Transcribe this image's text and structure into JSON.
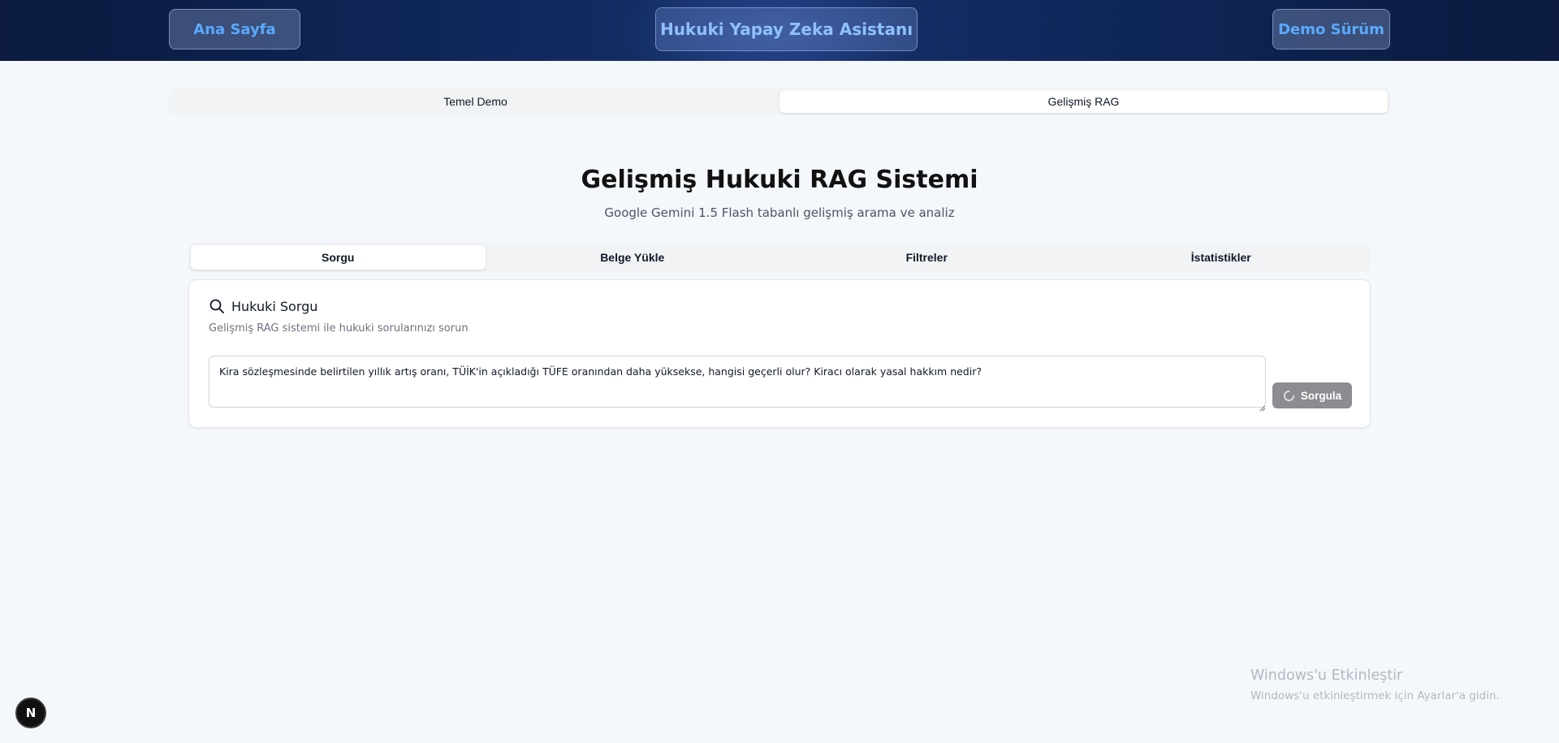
{
  "header": {
    "home_label": "Ana Sayfa",
    "title": "Hukuki Yapay Zeka Asistanı",
    "demo_label": "Demo Sürüm",
    "accent_color": "#5aa9ff",
    "background_color": "#0e2556"
  },
  "mode_tabs": [
    {
      "label": "Temel Demo",
      "active": false
    },
    {
      "label": "Gelişmiş RAG",
      "active": true
    }
  ],
  "page": {
    "title": "Gelişmiş Hukuki RAG Sistemi",
    "subtitle": "Google Gemini 1.5 Flash tabanlı gelişmiş arama ve analiz"
  },
  "inner_tabs": [
    {
      "label": "Sorgu",
      "active": true
    },
    {
      "label": "Belge Yükle",
      "active": false
    },
    {
      "label": "Filtreler",
      "active": false
    },
    {
      "label": "İstatistikler",
      "active": false
    }
  ],
  "query_card": {
    "icon": "search-icon",
    "title": "Hukuki Sorgu",
    "description": "Gelişmiş RAG sistemi ile hukuki sorularınızı sorun",
    "input_value": "Kira sözleşmesinde belirtilen yıllık artış oranı, TÜİK'in açıkladığı TÜFE oranından daha yüksekse, hangisi geçerli olur? Kiracı olarak yasal hakkım nedir?",
    "submit_label": "Sorgula",
    "submit_state": "loading",
    "submit_icon": "spinner-icon"
  },
  "windows_watermark": {
    "title": "Windows'u Etkinleştir",
    "subtitle": "Windows'u etkinleştirmek için Ayarlar'a gidin."
  },
  "next_badge": {
    "label": "N",
    "icon": "nextjs-logo-icon"
  }
}
